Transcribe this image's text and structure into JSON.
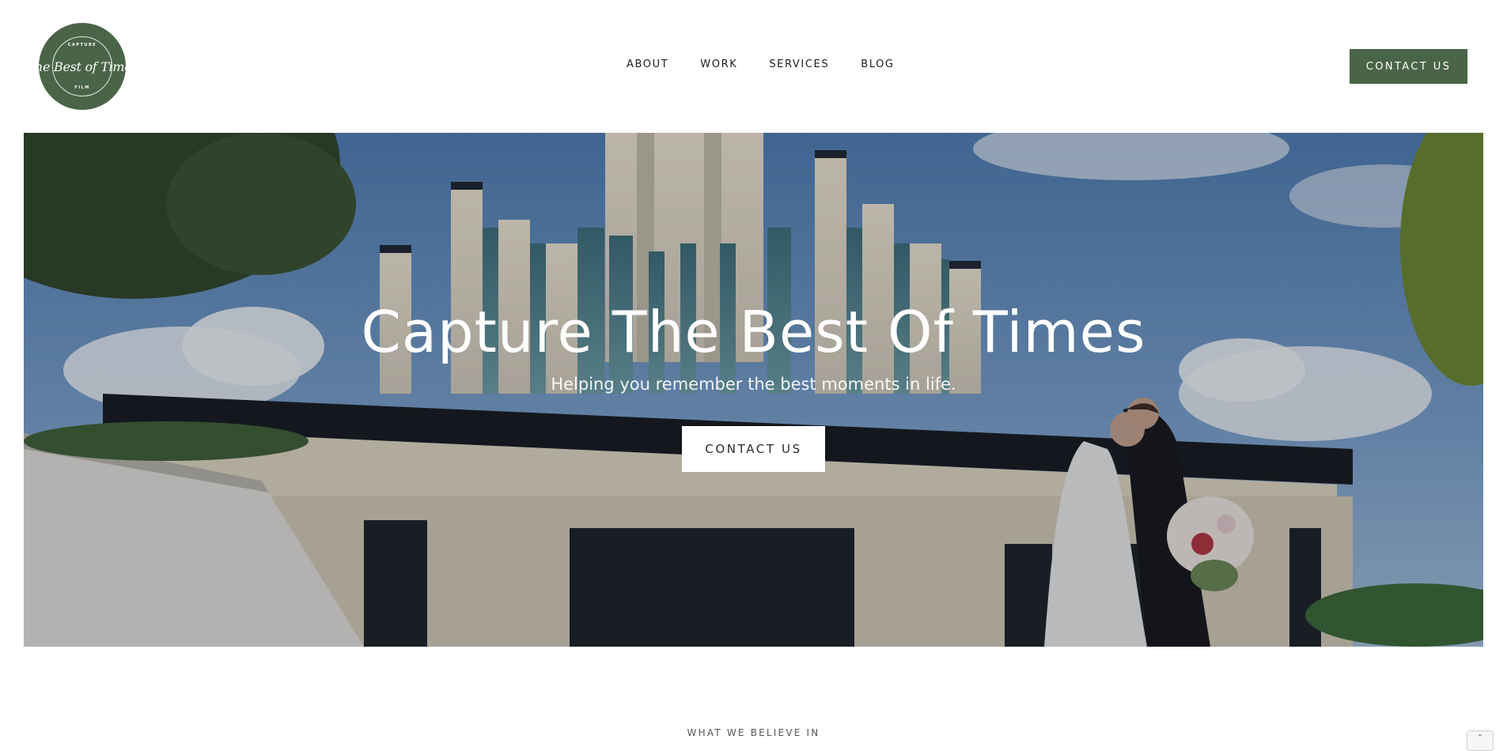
{
  "brand": {
    "logo_top_text": "CAPTURE",
    "logo_script_text": "The Best of Times",
    "logo_bottom_text": "FILM",
    "accent_color": "#4a6447"
  },
  "nav": {
    "items": [
      {
        "label": "ABOUT"
      },
      {
        "label": "WORK"
      },
      {
        "label": "SERVICES"
      },
      {
        "label": "BLOG"
      }
    ],
    "contact_label": "CONTACT US"
  },
  "hero": {
    "title": "Capture The Best Of Times",
    "subtitle": "Helping you remember the best moments in life.",
    "button_label": "CONTACT US",
    "background": "wedding-couple-temple-photo"
  },
  "section": {
    "eyebrow": "WHAT WE BELIEVE IN"
  },
  "scroll_top": {
    "icon": "chevron-up-icon",
    "glyph": "⌃"
  }
}
